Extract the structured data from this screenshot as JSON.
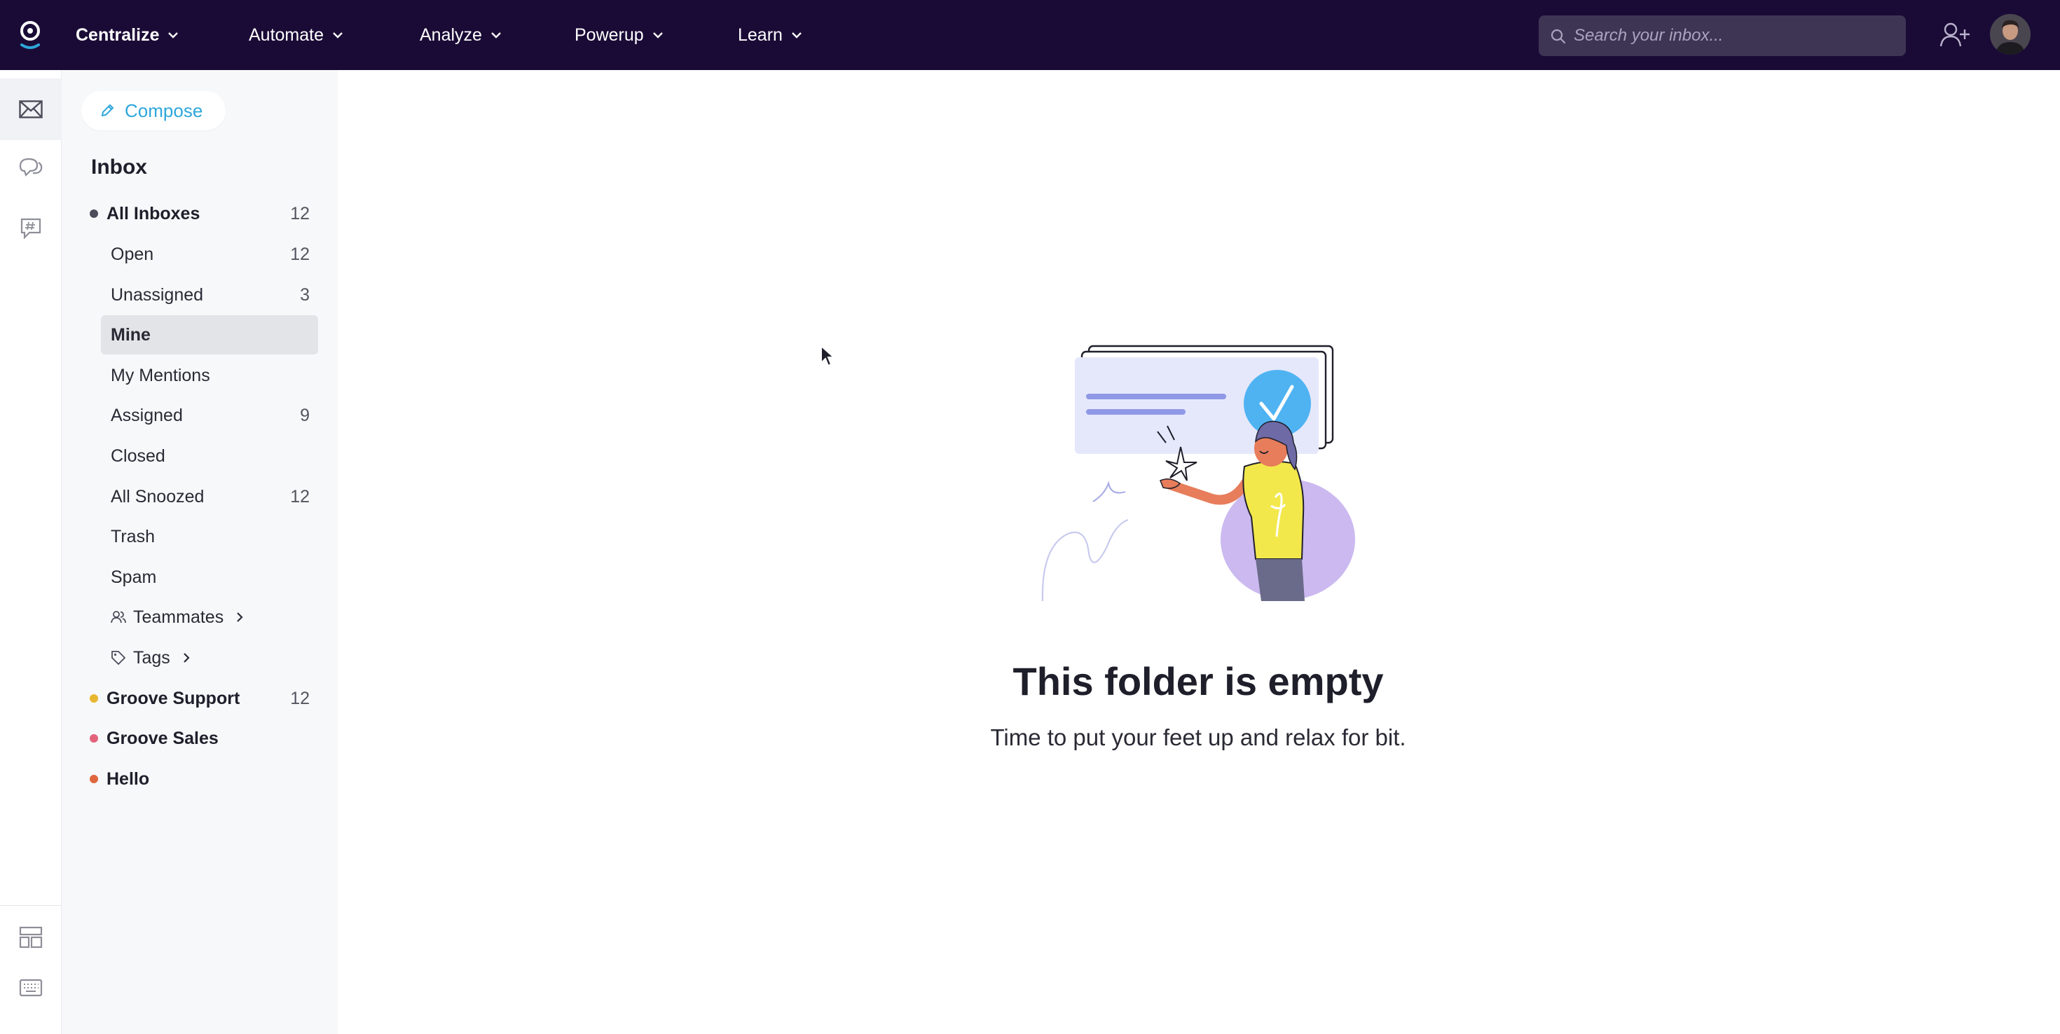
{
  "topnav": {
    "items": [
      {
        "label": "Centralize"
      },
      {
        "label": "Automate"
      },
      {
        "label": "Analyze"
      },
      {
        "label": "Powerup"
      },
      {
        "label": "Learn"
      }
    ],
    "search_placeholder": "Search your inbox..."
  },
  "icons": {
    "logo": "groove-logo-icon",
    "rail": [
      "mail-icon",
      "chat-icon",
      "channel-hash-icon",
      "layout-icon",
      "keyboard-icon"
    ],
    "add_user": "add-user-icon"
  },
  "sidebar": {
    "compose_label": "Compose",
    "heading": "Inbox",
    "all_inboxes": {
      "label": "All Inboxes",
      "count": "12"
    },
    "folders": [
      {
        "label": "Open",
        "count": "12"
      },
      {
        "label": "Unassigned",
        "count": "3"
      },
      {
        "label": "Mine",
        "count": ""
      },
      {
        "label": "My Mentions",
        "count": ""
      },
      {
        "label": "Assigned",
        "count": "9"
      },
      {
        "label": "Closed",
        "count": ""
      },
      {
        "label": "All Snoozed",
        "count": "12"
      },
      {
        "label": "Trash",
        "count": ""
      },
      {
        "label": "Spam",
        "count": ""
      }
    ],
    "teammates_label": "Teammates",
    "tags_label": "Tags",
    "mailboxes": [
      {
        "label": "Groove Support",
        "count": "12",
        "color": "#e8b730"
      },
      {
        "label": "Groove Sales",
        "count": "",
        "color": "#e2637a"
      },
      {
        "label": "Hello",
        "count": "",
        "color": "#e0673d"
      }
    ],
    "selected_folder": "Mine"
  },
  "main": {
    "empty_title": "This folder is empty",
    "empty_subtitle": "Time to put your feet up and relax for bit."
  },
  "colors": {
    "topbar": "#1a0b36",
    "accent": "#2ea7db",
    "sidebar_bg": "#f7f8fa",
    "selected_bg": "#e3e4e8"
  }
}
